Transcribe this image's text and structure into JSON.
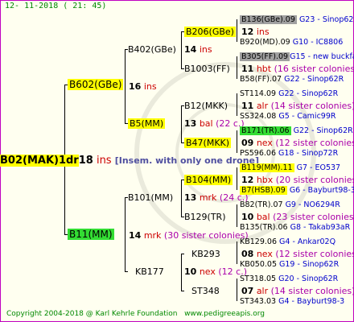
{
  "header": {
    "date": "12- 11-2018 ( 21: 45)"
  },
  "footer": {
    "copyright": "Copyright 2004-2018 @ Karl Kehrle Foundation",
    "website": "www.pedigreeapis.org"
  },
  "root": {
    "id": "B02(MAK)1dr",
    "num": "18",
    "sfx": "ins",
    "note": "[Insem. with only one drone]"
  },
  "gen1": {
    "top": {
      "id": "B602(GBe)",
      "num": "16",
      "sfx": "ins"
    },
    "bottom": {
      "id": "B11(MM)",
      "num": "14",
      "sfx": "mrk",
      "note": "(30 sister colonies)"
    }
  },
  "gen2": [
    {
      "id": "B402(GBe)",
      "num": "14",
      "sfx": "ins"
    },
    {
      "id": "B5(MM)",
      "num": "13",
      "sfx": "bal",
      "note": "(22 c.)"
    },
    {
      "id": "B101(MM)",
      "num": "13",
      "sfx": "mrk",
      "note": "(24 c.)"
    },
    {
      "id": "KB177",
      "num": "10",
      "sfx": "nex",
      "note": "(12 c.)"
    }
  ],
  "gen3": [
    {
      "id": "B206(GBe)",
      "num": "12",
      "sfx": "ins",
      "note": ""
    },
    {
      "id": "B1003(FF)",
      "num": "11",
      "sfx": "hbt",
      "note": "(16 sister colonies)"
    },
    {
      "id": "B12(MKK)",
      "num": "11",
      "sfx": "alr",
      "note": "(14 sister colonies)"
    },
    {
      "id": "B47(MKK)",
      "num": "09",
      "sfx": "nex",
      "note": "(12 sister colonies)"
    },
    {
      "id": "B104(MM)",
      "num": "12",
      "sfx": "hbx",
      "note": "(20 sister colonies)"
    },
    {
      "id": "B129(TR)",
      "num": "10",
      "sfx": "bal",
      "note": "(23 sister colonies)"
    },
    {
      "id": "KB293",
      "num": "08",
      "sfx": "nex",
      "note": "(12 sister colonies)"
    },
    {
      "id": "ST348",
      "num": "07",
      "sfx": "alr",
      "note": "(14 sister colonies)"
    }
  ],
  "gen4": [
    {
      "id": "B136(GBe).09",
      "note": "G23 - Sinop62R"
    },
    {
      "id": "B920(MD).09",
      "note": "G10 - IC8806"
    },
    {
      "id": "B305(FF).09",
      "note": "G15 - new buckfas"
    },
    {
      "id": "B58(FF).07",
      "note": "G22 - Sinop62R"
    },
    {
      "id": "ST114.09",
      "note": "G22 - Sinop62R"
    },
    {
      "id": "SS324.08",
      "note": "G5 - Camic99R"
    },
    {
      "id": "B171(TR).06",
      "note": "G22 - Sinop62R"
    },
    {
      "id": "PS596.06",
      "note": "G18 - Sinop72R"
    },
    {
      "id": "B119(MM).11",
      "note": "G7 - EO537"
    },
    {
      "id": "B7(HSB).09",
      "note": "G6 - Bayburt98-3"
    },
    {
      "id": "B82(TR).07",
      "note": "G9 - NO6294R"
    },
    {
      "id": "B135(TR).06",
      "note": "G8 - Takab93aR"
    },
    {
      "id": "KB129.06",
      "note": "G4 - Ankar02Q"
    },
    {
      "id": "KB050.05",
      "note": "G19 - Sinop62R"
    },
    {
      "id": "ST318.05",
      "note": "G20 - Sinop62R"
    },
    {
      "id": "ST343.03",
      "note": "G4 - Bayburt98-3"
    }
  ]
}
